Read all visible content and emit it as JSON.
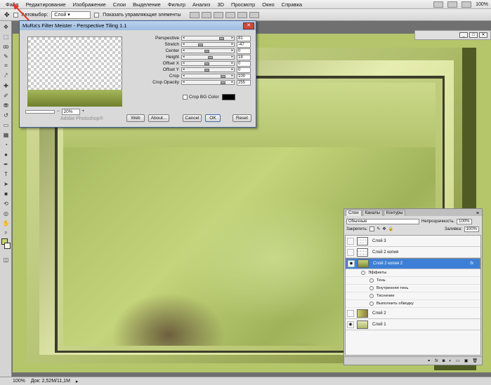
{
  "menubar": {
    "items": [
      "Файл",
      "Редактирование",
      "Изображение",
      "Слои",
      "Выделение",
      "Фильтр",
      "Анализ",
      "3D",
      "Просмотр",
      "Окно",
      "Справка"
    ],
    "zoom": "100%"
  },
  "options": {
    "autoselect_label": "Автовыбор:",
    "autoselect_value": "Слой",
    "show_controls_label": "Показать управляющие элементы"
  },
  "dialog": {
    "title": "MuRa's Filter Meister - Perspective Tiling 1.1",
    "close": "✕",
    "zoom": "20%",
    "brand": "Adobe Photoshop®",
    "params": [
      {
        "label": "Perspective",
        "value": "81",
        "level": 0.81
      },
      {
        "label": "Stretch",
        "value": "-47",
        "level": 0.3
      },
      {
        "label": "Center",
        "value": "0",
        "level": 0.44
      },
      {
        "label": "Height",
        "value": "18",
        "level": 0.54
      },
      {
        "label": "Offset X",
        "value": "0",
        "level": 0.44
      },
      {
        "label": "Offset Y",
        "value": "0",
        "level": 0.44
      },
      {
        "label": "Crop",
        "value": "100",
        "level": 0.84
      },
      {
        "label": "Crop Opacity",
        "value": "255",
        "level": 0.84
      }
    ],
    "crop_bg_label": "Crop BG Color",
    "buttons": {
      "web": "Web",
      "about": "About...",
      "cancel": "Cancel",
      "ok": "OK",
      "reset": "Reset"
    }
  },
  "layers_panel": {
    "tabs": [
      "Слои",
      "Каналы",
      "Контуры"
    ],
    "blend_mode": "Обычные",
    "opacity_label": "Непрозрачность:",
    "opacity_value": "100%",
    "lock_label": "Закрепить:",
    "fill_label": "Заливка:",
    "fill_value": "100%",
    "layers": [
      {
        "name": "Слой 3",
        "visible": false
      },
      {
        "name": "Слой 2 копия",
        "visible": false
      },
      {
        "name": "Слой 2 копия 2",
        "visible": true,
        "selected": true,
        "fx": "fx"
      },
      {
        "name": "Слой 2",
        "visible": false
      },
      {
        "name": "Слой 1",
        "visible": true
      }
    ],
    "effects_label": "Эффекты",
    "effects": [
      "Тень",
      "Внутренняя тень",
      "Тиснение",
      "Выполнить обводку"
    ]
  },
  "status": {
    "zoom": "100%",
    "doc": "Док: 2,52M/11,1M"
  },
  "colors": {
    "accent": "#3d7fd6",
    "annotation_arrow": "#e03a2a"
  }
}
